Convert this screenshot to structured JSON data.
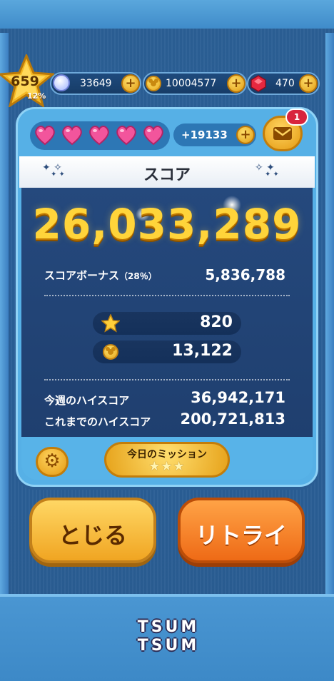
{
  "header": {
    "level": "659",
    "level_percent": "12%",
    "skill_tickets": "33649",
    "coins": "10004577",
    "rubies": "470"
  },
  "lives": {
    "hearts_count": 5,
    "extra_lives": "+19133",
    "mail_badge": "1"
  },
  "result": {
    "title": "スコア",
    "score": "26,033,289",
    "bonus_label": "スコアボーナス",
    "bonus_pct": "（28％）",
    "bonus_value": "5,836,788",
    "exp": "820",
    "coins_earned": "13,122",
    "weekly_high_label": "今週のハイスコア",
    "weekly_high_value": "36,942,171",
    "alltime_high_label": "これまでのハイスコア",
    "alltime_high_value": "200,721,813"
  },
  "mission": {
    "label": "今日のミッション",
    "stars": "★★★"
  },
  "buttons": {
    "close": "とじる",
    "retry": "リトライ"
  },
  "brand": {
    "line1": "TSUM",
    "line2": "TSUM"
  },
  "colors": {
    "score_gold": "#ffd43a",
    "heart_pink": "#f2559c",
    "retry_orange": "#ee6a16",
    "close_yellow": "#f0a522"
  }
}
